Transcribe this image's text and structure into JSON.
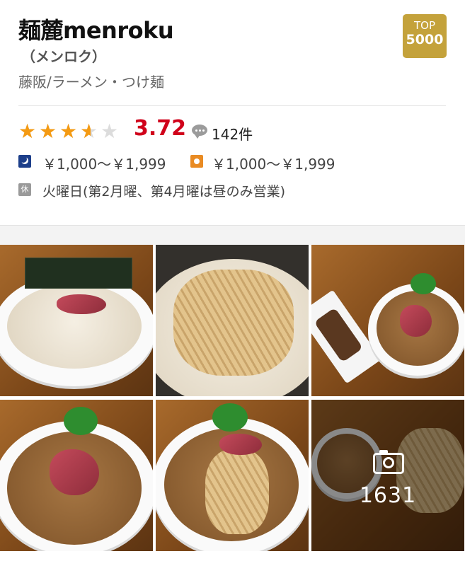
{
  "restaurant": {
    "name": "麺麓menroku",
    "kana": "（メンロク）",
    "genre": "藤阪/ラーメン・つけ麺",
    "award": {
      "line1": "TOP",
      "line2": "5000",
      "color": "#c4a23b"
    }
  },
  "rating": {
    "score": "3.72",
    "stars_value": 3.72,
    "stars_max": 5,
    "reviews": "142件",
    "score_color": "#d0021b",
    "star_color": "#f49a12"
  },
  "budget": {
    "dinner_icon": "moon-icon",
    "dinner": "￥1,000～￥1,999",
    "lunch_icon": "sun-icon",
    "lunch": "￥1,000～￥1,999"
  },
  "holiday": {
    "icon_label": "休",
    "text": "火曜日(第2月曜、第4月曜は昼のみ営業)"
  },
  "photos": {
    "count": "1631",
    "tiles": [
      "ramen-white-soup-photo",
      "noodles-closeup-photo",
      "tsukemen-brown-soup-photo",
      "ramen-brown-soup-photo",
      "noodles-lift-photo",
      "more-photos-tile"
    ]
  }
}
